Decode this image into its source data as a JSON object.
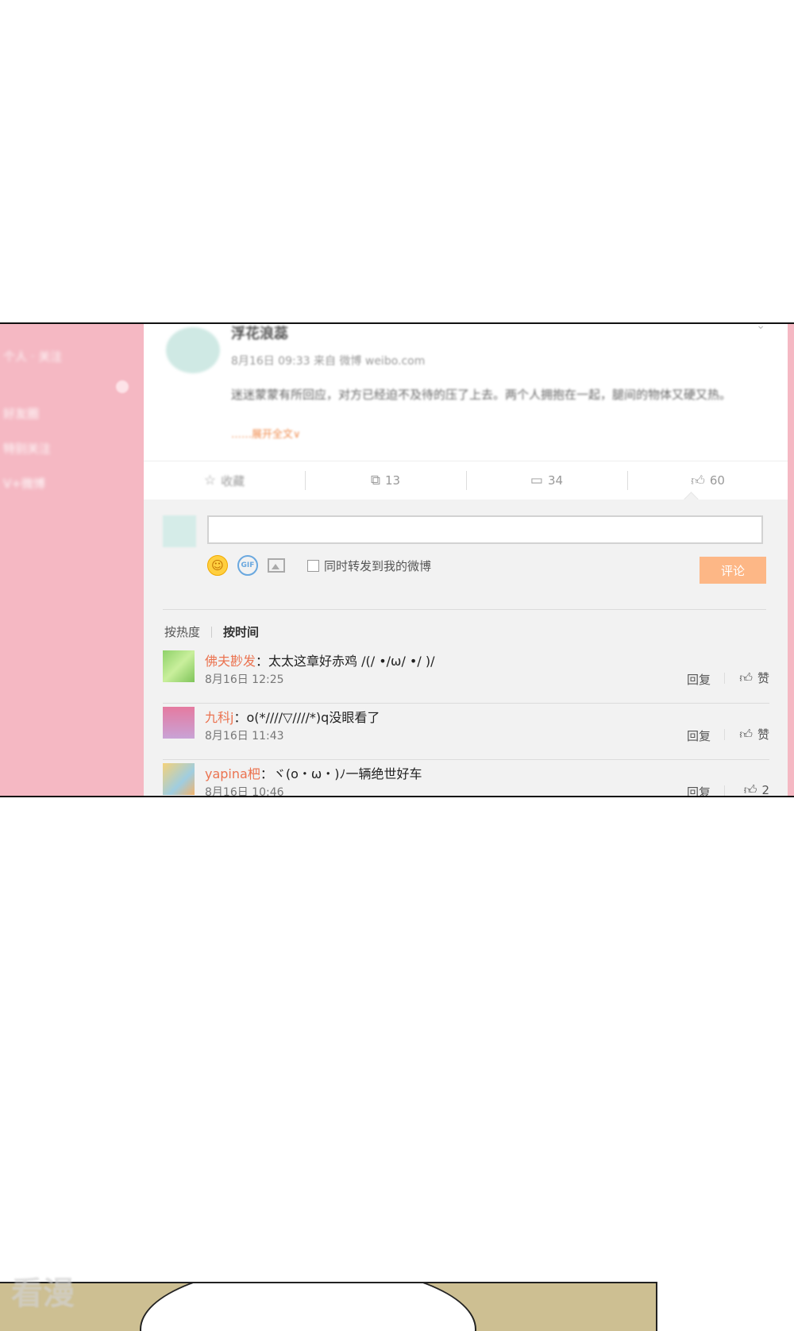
{
  "sidebar": {
    "items": [
      "个人 · 关注",
      "好友圈",
      "特别关注",
      "V+微博"
    ]
  },
  "post": {
    "author": "浮花浪蕊",
    "meta": "8月16日 09:33 来自 微博 weibo.com",
    "body": "迷迷蒙蒙有所回应，对方已经迫不及待的压了上去。两个人拥抱在一起，腿间的物体又硬又热。",
    "more": "……展开全文∨"
  },
  "actions": {
    "favorite": "收藏",
    "repost": "13",
    "comment": "34",
    "like": "60"
  },
  "composer": {
    "sync_label": "同时转发到我的微博",
    "submit_label": "评论",
    "gif_label": "GIF"
  },
  "sort": {
    "hot": "按热度",
    "time": "按时间"
  },
  "comments": [
    {
      "user": "佛夫尠发",
      "text": "太太这章好赤鸡 /(/ •/ω/ •/ )/",
      "time": "8月16日 12:25",
      "reply": "回复",
      "like": "赞"
    },
    {
      "user": "九科j",
      "text": "o(*////▽////*)q没眼看了",
      "time": "8月16日 11:43",
      "reply": "回复",
      "like": "赞"
    },
    {
      "user": "yapina杷",
      "text": "ヾ(o・ω・)ﾉ一辆绝世好车",
      "time": "8月16日 10:46",
      "reply": "回复",
      "like": "2"
    }
  ],
  "watermark": "看漫",
  "colors": {
    "sidebar": "#f5b8c3",
    "username": "#eb7350",
    "submit": "#fdb786"
  }
}
